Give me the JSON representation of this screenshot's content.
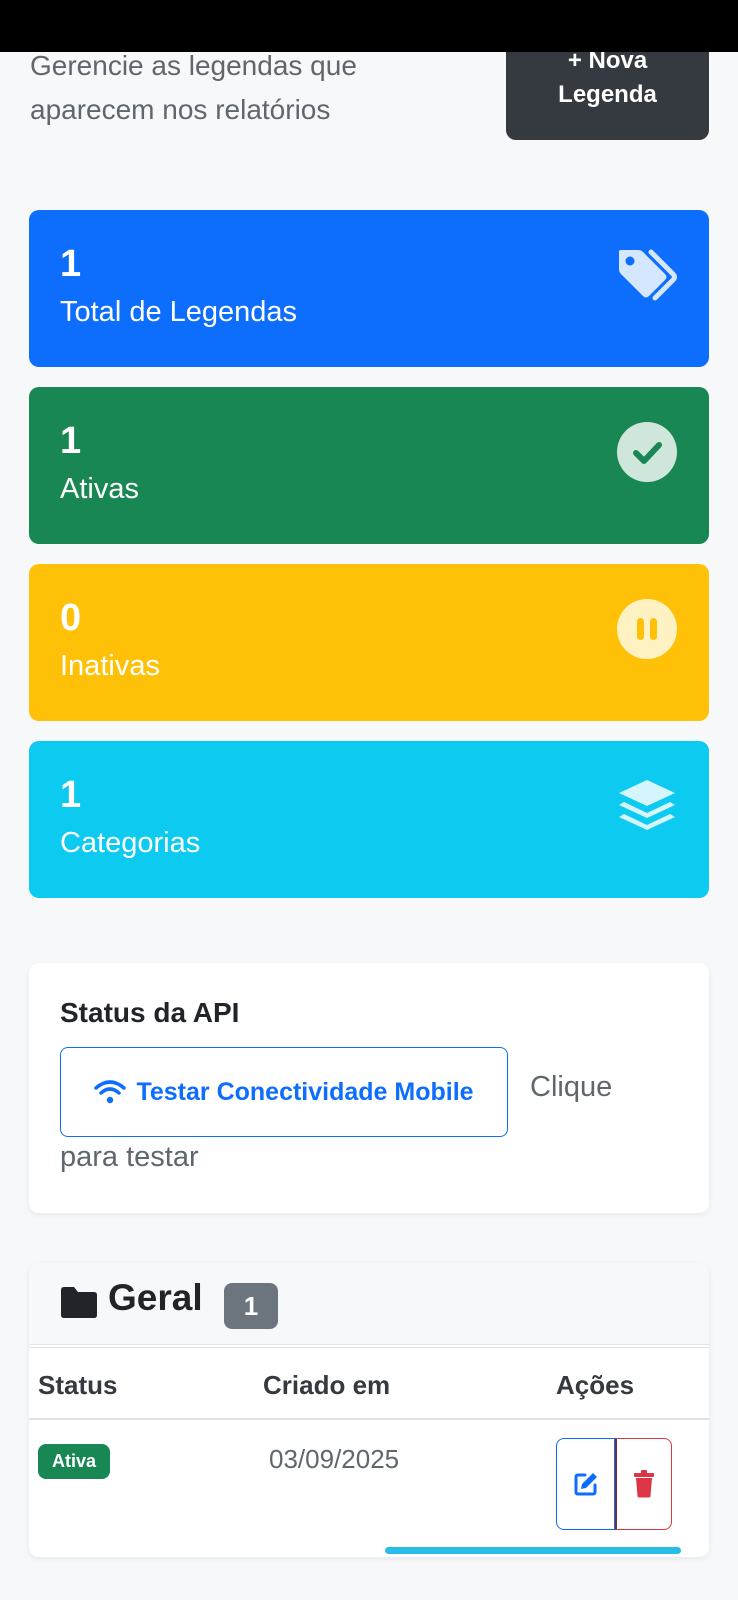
{
  "header": {
    "subtitle": "Gerencie as legendas que aparecem nos relatórios",
    "new_button_icon": "+",
    "new_button_line1": "Nova",
    "new_button_line2": "Legenda"
  },
  "stats": [
    {
      "value": "1",
      "label": "Total de Legendas",
      "icon": "tags-icon",
      "color": "#0d6efd"
    },
    {
      "value": "1",
      "label": "Ativas",
      "icon": "check-circle-icon",
      "color": "#198754"
    },
    {
      "value": "0",
      "label": "Inativas",
      "icon": "pause-circle-icon",
      "color": "#ffc107"
    },
    {
      "value": "1",
      "label": "Categorias",
      "icon": "layers-icon",
      "color": "#0dcaf0"
    }
  ],
  "api": {
    "title": "Status da API",
    "button_label": "Testar Conectividade Mobile",
    "button_icon": "wifi-icon",
    "hint_part1": "Clique",
    "hint_part2": "para testar"
  },
  "group": {
    "icon": "folder-icon",
    "title": "Geral",
    "count": "1",
    "columns": [
      "Status",
      "Criado em",
      "Ações"
    ],
    "rows": [
      {
        "status": "Ativa",
        "created": "03/09/2025",
        "actions": [
          "edit-icon",
          "trash-icon"
        ]
      }
    ]
  }
}
